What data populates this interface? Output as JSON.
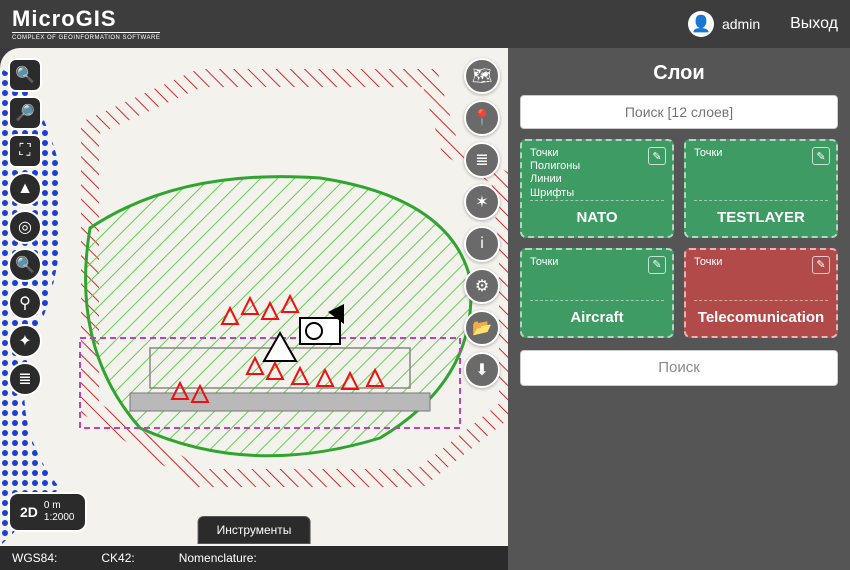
{
  "header": {
    "logo_main": "MicroGIS",
    "logo_sub": "COMPLEX OF GEOINFORMATION SOFTWARE",
    "user_name": "admin",
    "exit": "Выход"
  },
  "panel": {
    "title": "Слои",
    "search_placeholder": "Поиск [12 слоев]",
    "search_btn": "Поиск",
    "cards": [
      {
        "title": "NATO",
        "tags": "Точки\nПолигоны\nЛинии\nШрифты",
        "color": "green"
      },
      {
        "title": "TESTLAYER",
        "tags": "Точки",
        "color": "green"
      },
      {
        "title": "Aircraft",
        "tags": "Точки",
        "color": "green"
      },
      {
        "title": "Telecomunication",
        "tags": "Точки",
        "color": "red"
      }
    ]
  },
  "map_controls": {
    "bottom_pill": "Инструменты"
  },
  "scale": {
    "dim_label": "2D",
    "distance": "0 m",
    "ratio": "1:2000"
  },
  "statusbar": {
    "wgs84_label": "WGS84:",
    "wgs84_value": "",
    "ck42_label": "CK42:",
    "ck42_value": "",
    "nomen_label": "Nomenclature:",
    "nomen_value": ""
  },
  "icons": {
    "zoom_in": "＋",
    "zoom_out": "－",
    "fit": "⛶",
    "north": "▲",
    "gps": "◎",
    "measure": "🔍",
    "layers_pin": "⚲",
    "grid": "✦",
    "list": "≣",
    "map": "🗺",
    "pin": "📍",
    "stack": "≣",
    "sat": "✶",
    "info": "i",
    "gear": "⚙",
    "folder": "📂",
    "download": "⬇",
    "avatar": "👤",
    "edit": "✎"
  }
}
